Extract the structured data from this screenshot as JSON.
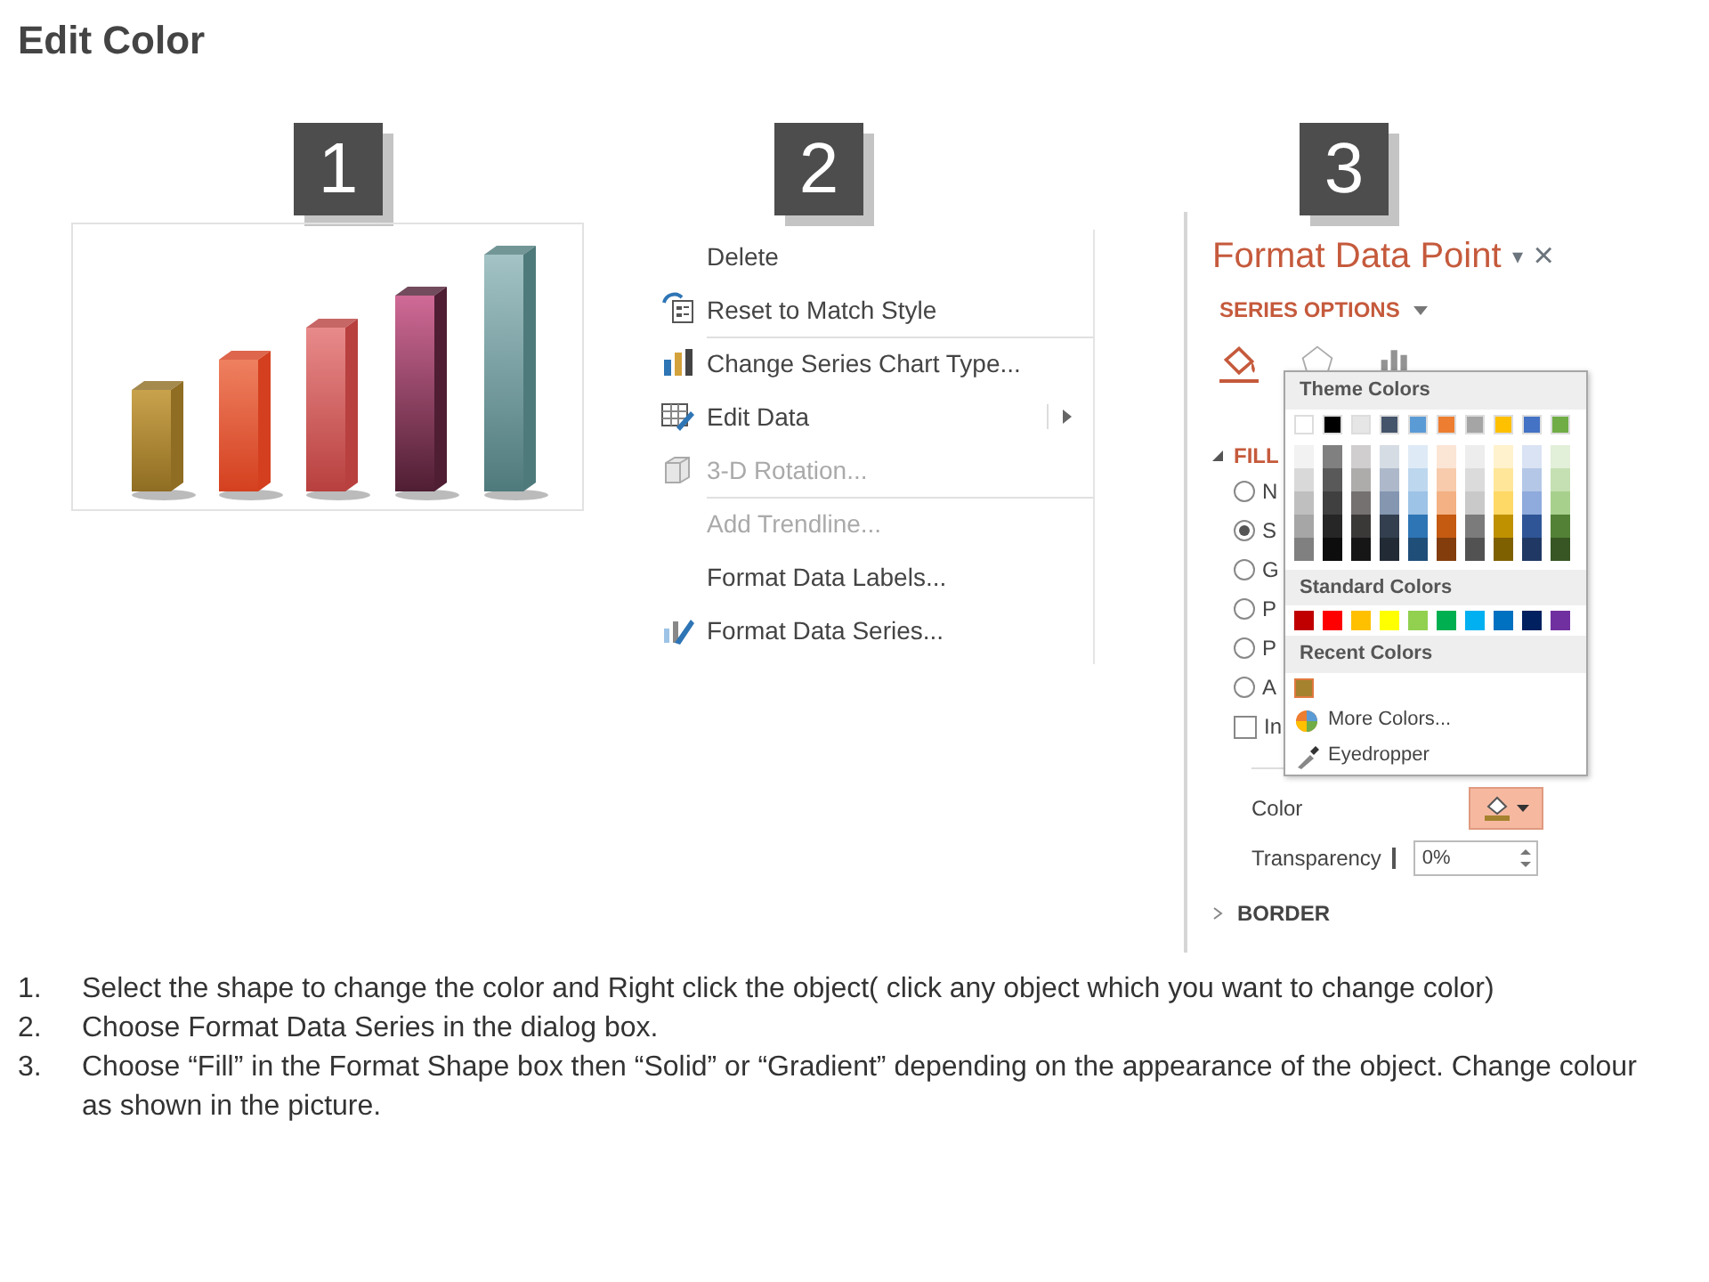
{
  "title": "Edit Color",
  "steps": [
    {
      "number": "1"
    },
    {
      "number": "2"
    },
    {
      "number": "3"
    }
  ],
  "context_menu": {
    "items": [
      {
        "label": "Delete",
        "disabled": false,
        "separator_before": false,
        "submenu": false
      },
      {
        "label": "Reset to Match Style",
        "disabled": false,
        "separator_before": false,
        "submenu": false
      },
      {
        "label": "Change Series Chart Type...",
        "disabled": false,
        "separator_before": true,
        "submenu": false
      },
      {
        "label": "Edit Data",
        "disabled": false,
        "separator_before": false,
        "submenu": true
      },
      {
        "label": "3-D Rotation...",
        "disabled": true,
        "separator_before": false,
        "submenu": false
      },
      {
        "label": "Add Trendline...",
        "disabled": true,
        "separator_before": true,
        "submenu": false
      },
      {
        "label": "Format Data Labels...",
        "disabled": false,
        "separator_before": false,
        "submenu": false
      },
      {
        "label": "Format Data Series...",
        "disabled": false,
        "separator_before": false,
        "submenu": false
      }
    ]
  },
  "format_pane": {
    "title": "Format Data Point",
    "dropdown": "▾",
    "close": "×",
    "series_options": "SERIES OPTIONS",
    "tabs": [
      {
        "selected": true
      },
      {
        "selected": false
      },
      {
        "selected": false
      }
    ],
    "fill": {
      "label": "FILL",
      "expanded": true,
      "options": [
        {
          "label": "N",
          "kind": "radio",
          "selected": false
        },
        {
          "label": "S",
          "kind": "radio",
          "selected": true
        },
        {
          "label": "G",
          "kind": "radio",
          "selected": false
        },
        {
          "label": "P",
          "kind": "radio",
          "selected": false
        },
        {
          "label": "P",
          "kind": "radio",
          "selected": false
        },
        {
          "label": "A",
          "kind": "radio",
          "selected": false
        },
        {
          "label": "In",
          "kind": "checkbox",
          "selected": false
        }
      ],
      "color_label": "Color",
      "color_button": {
        "expanded": true
      },
      "transparency_label": "Transparency",
      "transparency_slider": {
        "level": 0
      },
      "transparency_value": "0%"
    },
    "border": {
      "label": "BORDER",
      "expanded": false
    },
    "palette": {
      "theme_header": "Theme Colors",
      "theme_colors": [
        {
          "color": "#ffffff",
          "shades": [
            {
              "color": "#f2f2f2"
            },
            {
              "color": "#d9d9d9"
            },
            {
              "color": "#bfbfbf"
            },
            {
              "color": "#a6a6a6"
            },
            {
              "color": "#808080"
            }
          ]
        },
        {
          "color": "#000000",
          "shades": [
            {
              "color": "#808080"
            },
            {
              "color": "#595959"
            },
            {
              "color": "#404040"
            },
            {
              "color": "#262626"
            },
            {
              "color": "#0d0d0d"
            }
          ]
        },
        {
          "color": "#e7e6e6",
          "shades": [
            {
              "color": "#d0cece"
            },
            {
              "color": "#aeabab"
            },
            {
              "color": "#757171"
            },
            {
              "color": "#3b3838"
            },
            {
              "color": "#171616"
            }
          ]
        },
        {
          "color": "#44546a",
          "shades": [
            {
              "color": "#d6dce4"
            },
            {
              "color": "#adb9ca"
            },
            {
              "color": "#8496b0"
            },
            {
              "color": "#333f4f"
            },
            {
              "color": "#222a35"
            }
          ]
        },
        {
          "color": "#5b9bd5",
          "shades": [
            {
              "color": "#deebf6"
            },
            {
              "color": "#bdd7ee"
            },
            {
              "color": "#9dc3e6"
            },
            {
              "color": "#2e75b5"
            },
            {
              "color": "#1f4e79"
            }
          ]
        },
        {
          "color": "#ed7d31",
          "shades": [
            {
              "color": "#fbe5d5"
            },
            {
              "color": "#f7cbac"
            },
            {
              "color": "#f4b183"
            },
            {
              "color": "#c55a11"
            },
            {
              "color": "#833c0b"
            }
          ]
        },
        {
          "color": "#a5a5a5",
          "shades": [
            {
              "color": "#ededed"
            },
            {
              "color": "#dbdbdb"
            },
            {
              "color": "#c9c9c9"
            },
            {
              "color": "#7b7b7b"
            },
            {
              "color": "#525252"
            }
          ]
        },
        {
          "color": "#ffc000",
          "shades": [
            {
              "color": "#fff2cc"
            },
            {
              "color": "#ffe699"
            },
            {
              "color": "#ffd966"
            },
            {
              "color": "#bf9000"
            },
            {
              "color": "#7f6000"
            }
          ]
        },
        {
          "color": "#4472c4",
          "shades": [
            {
              "color": "#dae3f3"
            },
            {
              "color": "#b4c7e7"
            },
            {
              "color": "#8faadc"
            },
            {
              "color": "#2f5597"
            },
            {
              "color": "#203864"
            }
          ]
        },
        {
          "color": "#70ad47",
          "shades": [
            {
              "color": "#e2efd9"
            },
            {
              "color": "#c5e0b3"
            },
            {
              "color": "#a8d08d"
            },
            {
              "color": "#538135"
            },
            {
              "color": "#375623"
            }
          ]
        }
      ],
      "standard_header": "Standard Colors",
      "standard_colors": [
        {
          "color": "#c00000"
        },
        {
          "color": "#ff0000"
        },
        {
          "color": "#ffc000"
        },
        {
          "color": "#ffff00"
        },
        {
          "color": "#92d050"
        },
        {
          "color": "#00b050"
        },
        {
          "color": "#00b0f0"
        },
        {
          "color": "#0070c0"
        },
        {
          "color": "#002060"
        },
        {
          "color": "#7030a0"
        }
      ],
      "recent_header": "Recent Colors",
      "recent_colors": [
        {
          "color": "#a5822e"
        }
      ],
      "more_colors": "More Colors...",
      "eyedropper": "Eyedropper"
    }
  },
  "instructions": [
    {
      "number": "1.",
      "text": "Select the shape to change the color and Right click the object( click any object which you want to change color)"
    },
    {
      "number": "2.",
      "text": "Choose Format Data Series in the dialog box."
    },
    {
      "number": "3.",
      "text": "Choose “Fill” in the Format Shape box then “Solid” or “Gradient” depending on the appearance of the object. Change colour as shown in the picture."
    }
  ]
}
